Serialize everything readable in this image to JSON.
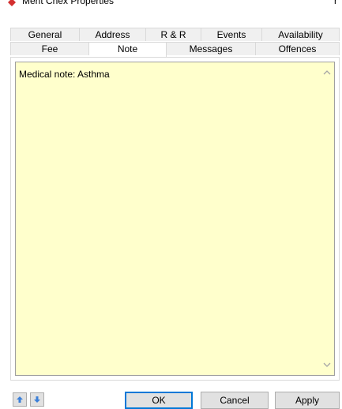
{
  "window": {
    "title": "Merit Chex Properties",
    "title_right": "r"
  },
  "tabs": {
    "row1": [
      "General",
      "Address",
      "R & R",
      "Events",
      "Availability"
    ],
    "row2": [
      "Fee",
      "Note",
      "Messages",
      "Offences"
    ],
    "selected": "Note"
  },
  "note": {
    "text": "Medical note: Asthma"
  },
  "buttons": {
    "ok": "OK",
    "cancel": "Cancel",
    "apply": "Apply"
  },
  "icons": {
    "title": "red-diamond-icon",
    "move_up": "blue-up-arrow-icon",
    "move_down": "blue-down-arrow-icon",
    "scroll_up": "chevron-up-icon",
    "scroll_down": "chevron-down-icon"
  },
  "colors": {
    "note_bg": "#ffffcc",
    "accent": "#0078d7",
    "title_icon": "#d32f2f",
    "arrow": "#3b7fd8"
  }
}
